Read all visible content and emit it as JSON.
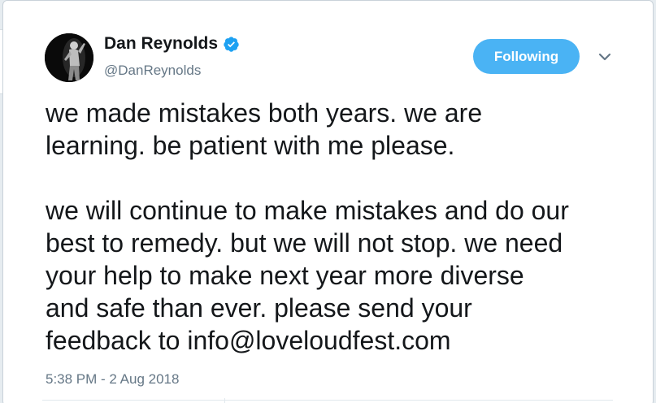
{
  "tweet": {
    "author": {
      "name": "Dan Reynolds",
      "handle": "@DanReynolds",
      "verified": true
    },
    "follow_button_label": "Following",
    "text_lines": {
      "p1_line1": "we made mistakes both years. we are",
      "p1_line2": "learning. be patient with me please.",
      "p2_line1": "we will continue to make mistakes and do our",
      "p2_line2": "best to remedy. but we will not stop. we need",
      "p2_line3": "your help to make next year more diverse",
      "p2_line4": "and safe than ever. please send your",
      "p2_line5_prefix": "feedback to ",
      "email": "info@loveloudfest.com"
    },
    "timestamp": "5:38 PM - 2 Aug 2018"
  },
  "colors": {
    "follow_button": "#4ab3f4",
    "verified_badge": "#1da1f2",
    "text": "#14171a",
    "meta": "#657786",
    "background": "#e6ecf0"
  },
  "icons": {
    "verified": "verified-badge-icon",
    "caret": "chevron-down-icon"
  }
}
